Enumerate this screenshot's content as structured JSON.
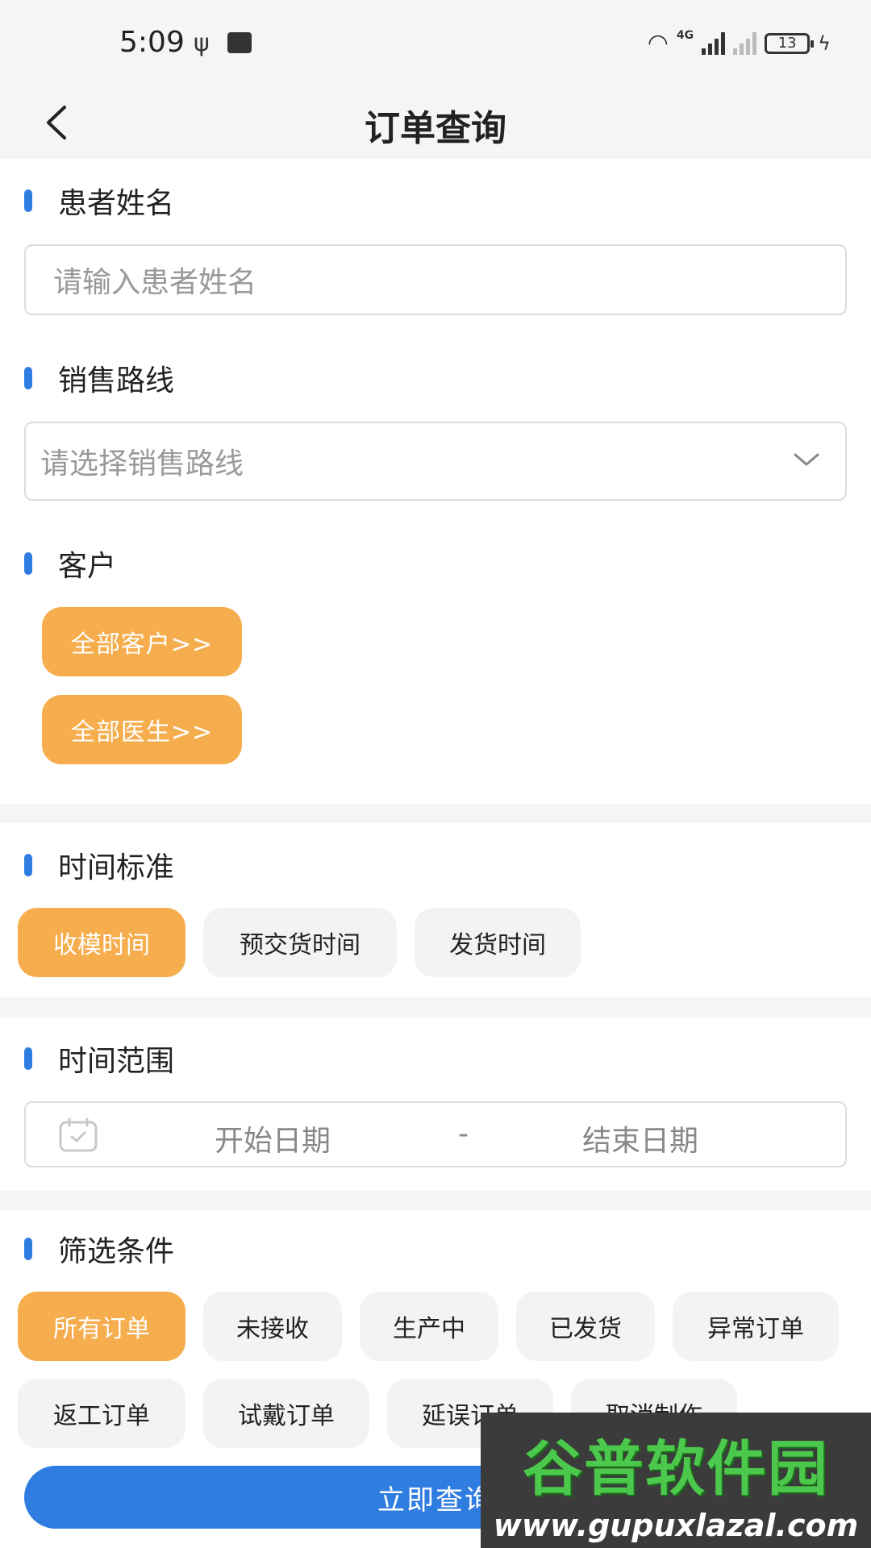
{
  "status_bar": {
    "time": "5:09",
    "network": "4G",
    "battery": "13"
  },
  "nav": {
    "title": "订单查询"
  },
  "patient": {
    "label": "患者姓名",
    "placeholder": "请输入患者姓名"
  },
  "sales_route": {
    "label": "销售路线",
    "placeholder": "请选择销售路线"
  },
  "customer": {
    "label": "客户",
    "all_customers": "全部客户>>",
    "all_doctors": "全部医生>>"
  },
  "time_standard": {
    "label": "时间标准",
    "options": [
      "收模时间",
      "预交货时间",
      "发货时间"
    ],
    "selected": "收模时间"
  },
  "time_range": {
    "label": "时间范围",
    "start_placeholder": "开始日期",
    "separator": "-",
    "end_placeholder": "结束日期"
  },
  "filter": {
    "label": "筛选条件",
    "options": [
      "所有订单",
      "未接收",
      "生产中",
      "已发货",
      "异常订单",
      "返工订单",
      "试戴订单",
      "延误订单",
      "取消制作"
    ],
    "selected": "所有订单"
  },
  "query_button": "立即查询",
  "watermark": {
    "logo": "谷普软件园",
    "url": "www.gupuxlazal.com"
  },
  "colors": {
    "accent_blue": "#2f7de1",
    "accent_orange": "#f5ad4d",
    "chip_gray": "#f3f3f3"
  }
}
